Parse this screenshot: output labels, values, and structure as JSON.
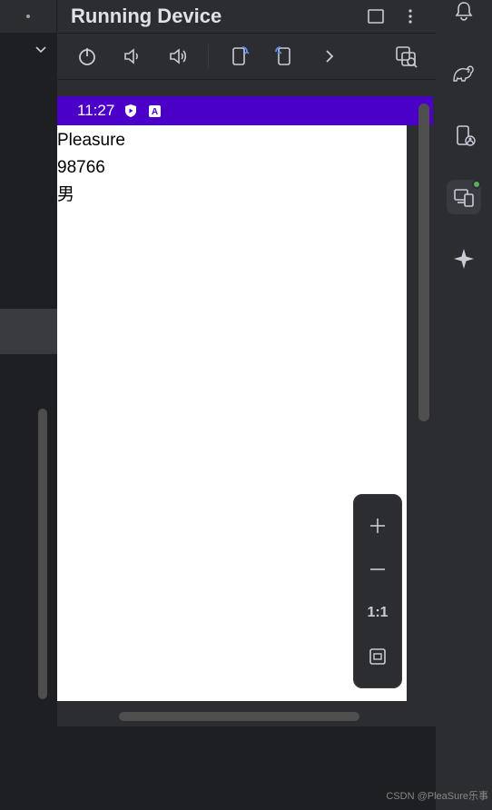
{
  "title": "Running Device",
  "toolbar": {
    "power": "power-icon",
    "vol_down": "volume-down-icon",
    "vol_up": "volume-up-icon",
    "rotate_l": "rotate-left-icon",
    "rotate_r": "rotate-right-icon",
    "more": "chevron-right-icon",
    "screenshot": "screenshot-icon"
  },
  "device": {
    "status_time": "11:27",
    "content_lines": [
      "Pleasure",
      "98766",
      "男"
    ]
  },
  "zoom": {
    "one_to_one": "1:1"
  },
  "right": {
    "items": [
      "bell-icon",
      "gradle-icon",
      "device-manager-icon",
      "running-devices-icon",
      "sparkle-icon"
    ]
  },
  "watermark": "CSDN @PleaSure乐事"
}
